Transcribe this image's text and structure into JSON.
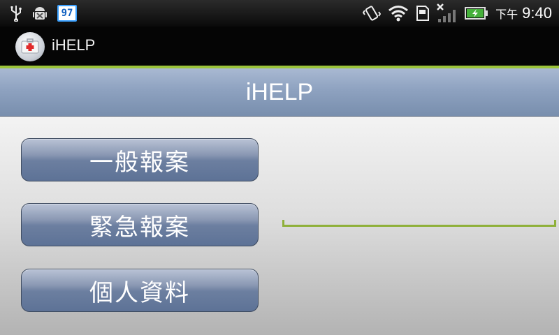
{
  "status_bar": {
    "battery_badge": "97",
    "ampm": "下午",
    "time": "9:40",
    "icons": [
      "usb-icon",
      "android-debug-icon",
      "battery-badge-icon",
      "vibrate-icon",
      "wifi-icon",
      "sd-card-icon",
      "no-signal-icon",
      "battery-charging-icon"
    ]
  },
  "app_bar": {
    "title": "iHELP",
    "logo_icon": "first-aid-kit-icon"
  },
  "header": {
    "title": "iHELP"
  },
  "menu": {
    "items": [
      {
        "label": "一般報案"
      },
      {
        "label": "緊急報案"
      },
      {
        "label": "個人資料"
      }
    ]
  },
  "colors": {
    "accent_green": "#9cc43a",
    "button_blue": "#6c7fa0",
    "header_blue": "#8ea2c0"
  }
}
